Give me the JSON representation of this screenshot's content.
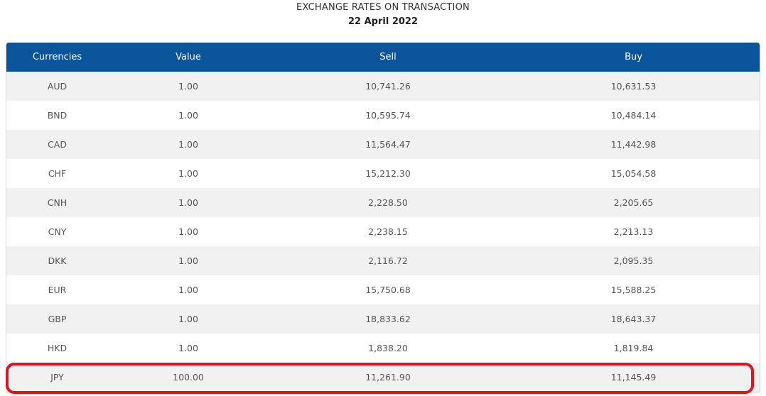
{
  "heading": {
    "title": "EXCHANGE RATES ON TRANSACTION",
    "date": "22 April 2022"
  },
  "table": {
    "headers": [
      "Currencies",
      "Value",
      "Sell",
      "Buy"
    ],
    "rows": [
      {
        "currency": "AUD",
        "value": "1.00",
        "sell": "10,741.26",
        "buy": "10,631.53"
      },
      {
        "currency": "BND",
        "value": "1.00",
        "sell": "10,595.74",
        "buy": "10,484.14"
      },
      {
        "currency": "CAD",
        "value": "1.00",
        "sell": "11,564.47",
        "buy": "11,442.98"
      },
      {
        "currency": "CHF",
        "value": "1.00",
        "sell": "15,212.30",
        "buy": "15,054.58"
      },
      {
        "currency": "CNH",
        "value": "1.00",
        "sell": "2,228.50",
        "buy": "2,205.65"
      },
      {
        "currency": "CNY",
        "value": "1.00",
        "sell": "2,238.15",
        "buy": "2,213.13"
      },
      {
        "currency": "DKK",
        "value": "1.00",
        "sell": "2,116.72",
        "buy": "2,095.35"
      },
      {
        "currency": "EUR",
        "value": "1.00",
        "sell": "15,750.68",
        "buy": "15,588.25"
      },
      {
        "currency": "GBP",
        "value": "1.00",
        "sell": "18,833.62",
        "buy": "18,643.37"
      },
      {
        "currency": "HKD",
        "value": "1.00",
        "sell": "1,838.20",
        "buy": "1,819.84"
      },
      {
        "currency": "JPY",
        "value": "100.00",
        "sell": "11,261.90",
        "buy": "11,145.49"
      }
    ]
  },
  "highlight": {
    "row_currency": "JPY",
    "color": "#e0141e"
  },
  "colors": {
    "header_bg": "#0a5499",
    "row_alt_bg": "#f1f1f1"
  }
}
